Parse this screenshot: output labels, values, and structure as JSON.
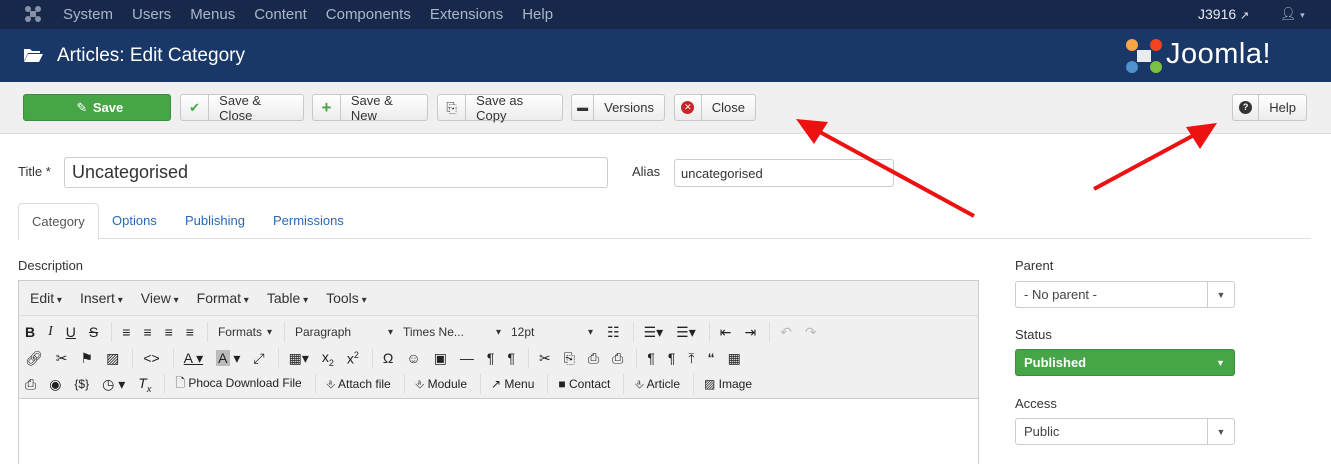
{
  "topnav": {
    "menu": [
      "System",
      "Users",
      "Menus",
      "Content",
      "Components",
      "Extensions",
      "Help"
    ],
    "site_name": "J3916",
    "joomla_icon": "joomla-logo-icon",
    "user_icon": "user-icon"
  },
  "header": {
    "title": "Articles: Edit Category",
    "brand": "Joomla!"
  },
  "toolbar": {
    "save": "Save",
    "save_close": "Save & Close",
    "save_new": "Save & New",
    "save_copy": "Save as Copy",
    "versions": "Versions",
    "close": "Close",
    "help": "Help"
  },
  "form": {
    "title_label": "Title *",
    "title_value": "Uncategorised",
    "alias_label": "Alias",
    "alias_value": "uncategorised"
  },
  "tabs": [
    "Category",
    "Options",
    "Publishing",
    "Permissions"
  ],
  "editor": {
    "label": "Description",
    "menu": [
      "Edit",
      "Insert",
      "View",
      "Format",
      "Table",
      "Tools"
    ],
    "formats": "Formats",
    "block": "Paragraph",
    "font": "Times Ne...",
    "size": "12pt",
    "buttons": {
      "phoca": "Phoca Download File",
      "attach": "Attach file",
      "module": "Module",
      "menu": "Menu",
      "contact": "Contact",
      "article": "Article",
      "image": "Image"
    }
  },
  "sidebar": {
    "parent_label": "Parent",
    "parent_value": "- No parent -",
    "status_label": "Status",
    "status_value": "Published",
    "access_label": "Access",
    "access_value": "Public"
  },
  "colors": {
    "nav": "#17284a",
    "header": "#1a3867",
    "save_green": "#46a546",
    "link": "#2a69b8",
    "annotation_arrow": "#ee1111"
  }
}
